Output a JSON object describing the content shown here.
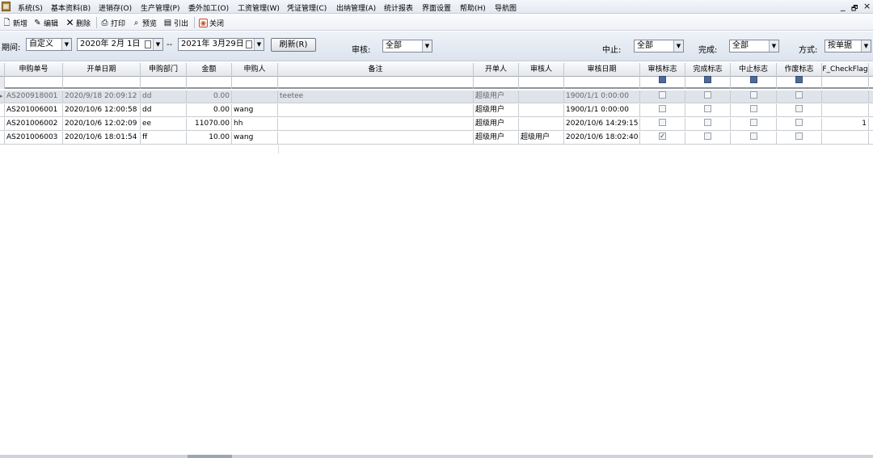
{
  "menubar": {
    "items": [
      "系统(S)",
      "基本资料(B)",
      "进销存(O)",
      "生产管理(P)",
      "委外加工(O)",
      "工资管理(W)",
      "凭证管理(C)",
      "出纳管理(A)",
      "统计报表",
      "界面设置",
      "帮助(H)",
      "导航图"
    ],
    "window_controls": [
      "_",
      "🗗",
      "×"
    ]
  },
  "toolbar": {
    "new": "新增",
    "edit": "编辑",
    "delete": "删除",
    "print": "打印",
    "preview": "预览",
    "export": "引出",
    "close": "关闭"
  },
  "filter": {
    "period_label": "期间:",
    "period_value": "自定义",
    "date_from": "2020年  2月  1日",
    "date_sep": "--",
    "date_to": "2021年  3月29日",
    "refresh": "刷新(R)",
    "audit_label": "审核:",
    "audit_value": "全部",
    "suspend_label": "中止:",
    "suspend_value": "全部",
    "complete_label": "完成:",
    "complete_value": "全部",
    "mode_label": "方式:",
    "mode_value": "按单据"
  },
  "grid": {
    "columns": [
      "申购单号",
      "开单日期",
      "申购部门",
      "金额",
      "申购人",
      "备注",
      "开单人",
      "审核人",
      "审核日期",
      "审核标志",
      "完成标志",
      "中止标志",
      "作废标志",
      "F_CheckFlag"
    ],
    "rows": [
      {
        "id": "AS200918001",
        "date": "2020/9/18 20:09:12",
        "dept": "dd",
        "amount": "0.00",
        "requester": "",
        "note": "teetee",
        "creator": "超级用户",
        "auditor": "",
        "audit_date": "1900/1/1 0:00:00",
        "audited": false,
        "flag": ""
      },
      {
        "id": "AS201006001",
        "date": "2020/10/6 12:00:58",
        "dept": "dd",
        "amount": "0.00",
        "requester": "wang",
        "note": "",
        "creator": "超级用户",
        "auditor": "",
        "audit_date": "1900/1/1 0:00:00",
        "audited": false,
        "flag": ""
      },
      {
        "id": "AS201006002",
        "date": "2020/10/6 12:02:09",
        "dept": "ee",
        "amount": "11070.00",
        "requester": "hh",
        "note": "",
        "creator": "超级用户",
        "auditor": "",
        "audit_date": "2020/10/6 14:29:15",
        "audited": false,
        "flag": "1"
      },
      {
        "id": "AS201006003",
        "date": "2020/10/6 18:01:54",
        "dept": "ff",
        "amount": "10.00",
        "requester": "wang",
        "note": "",
        "creator": "超级用户",
        "auditor": "超级用户",
        "audit_date": "2020/10/6 18:02:40",
        "audited": true,
        "flag": ""
      }
    ]
  }
}
